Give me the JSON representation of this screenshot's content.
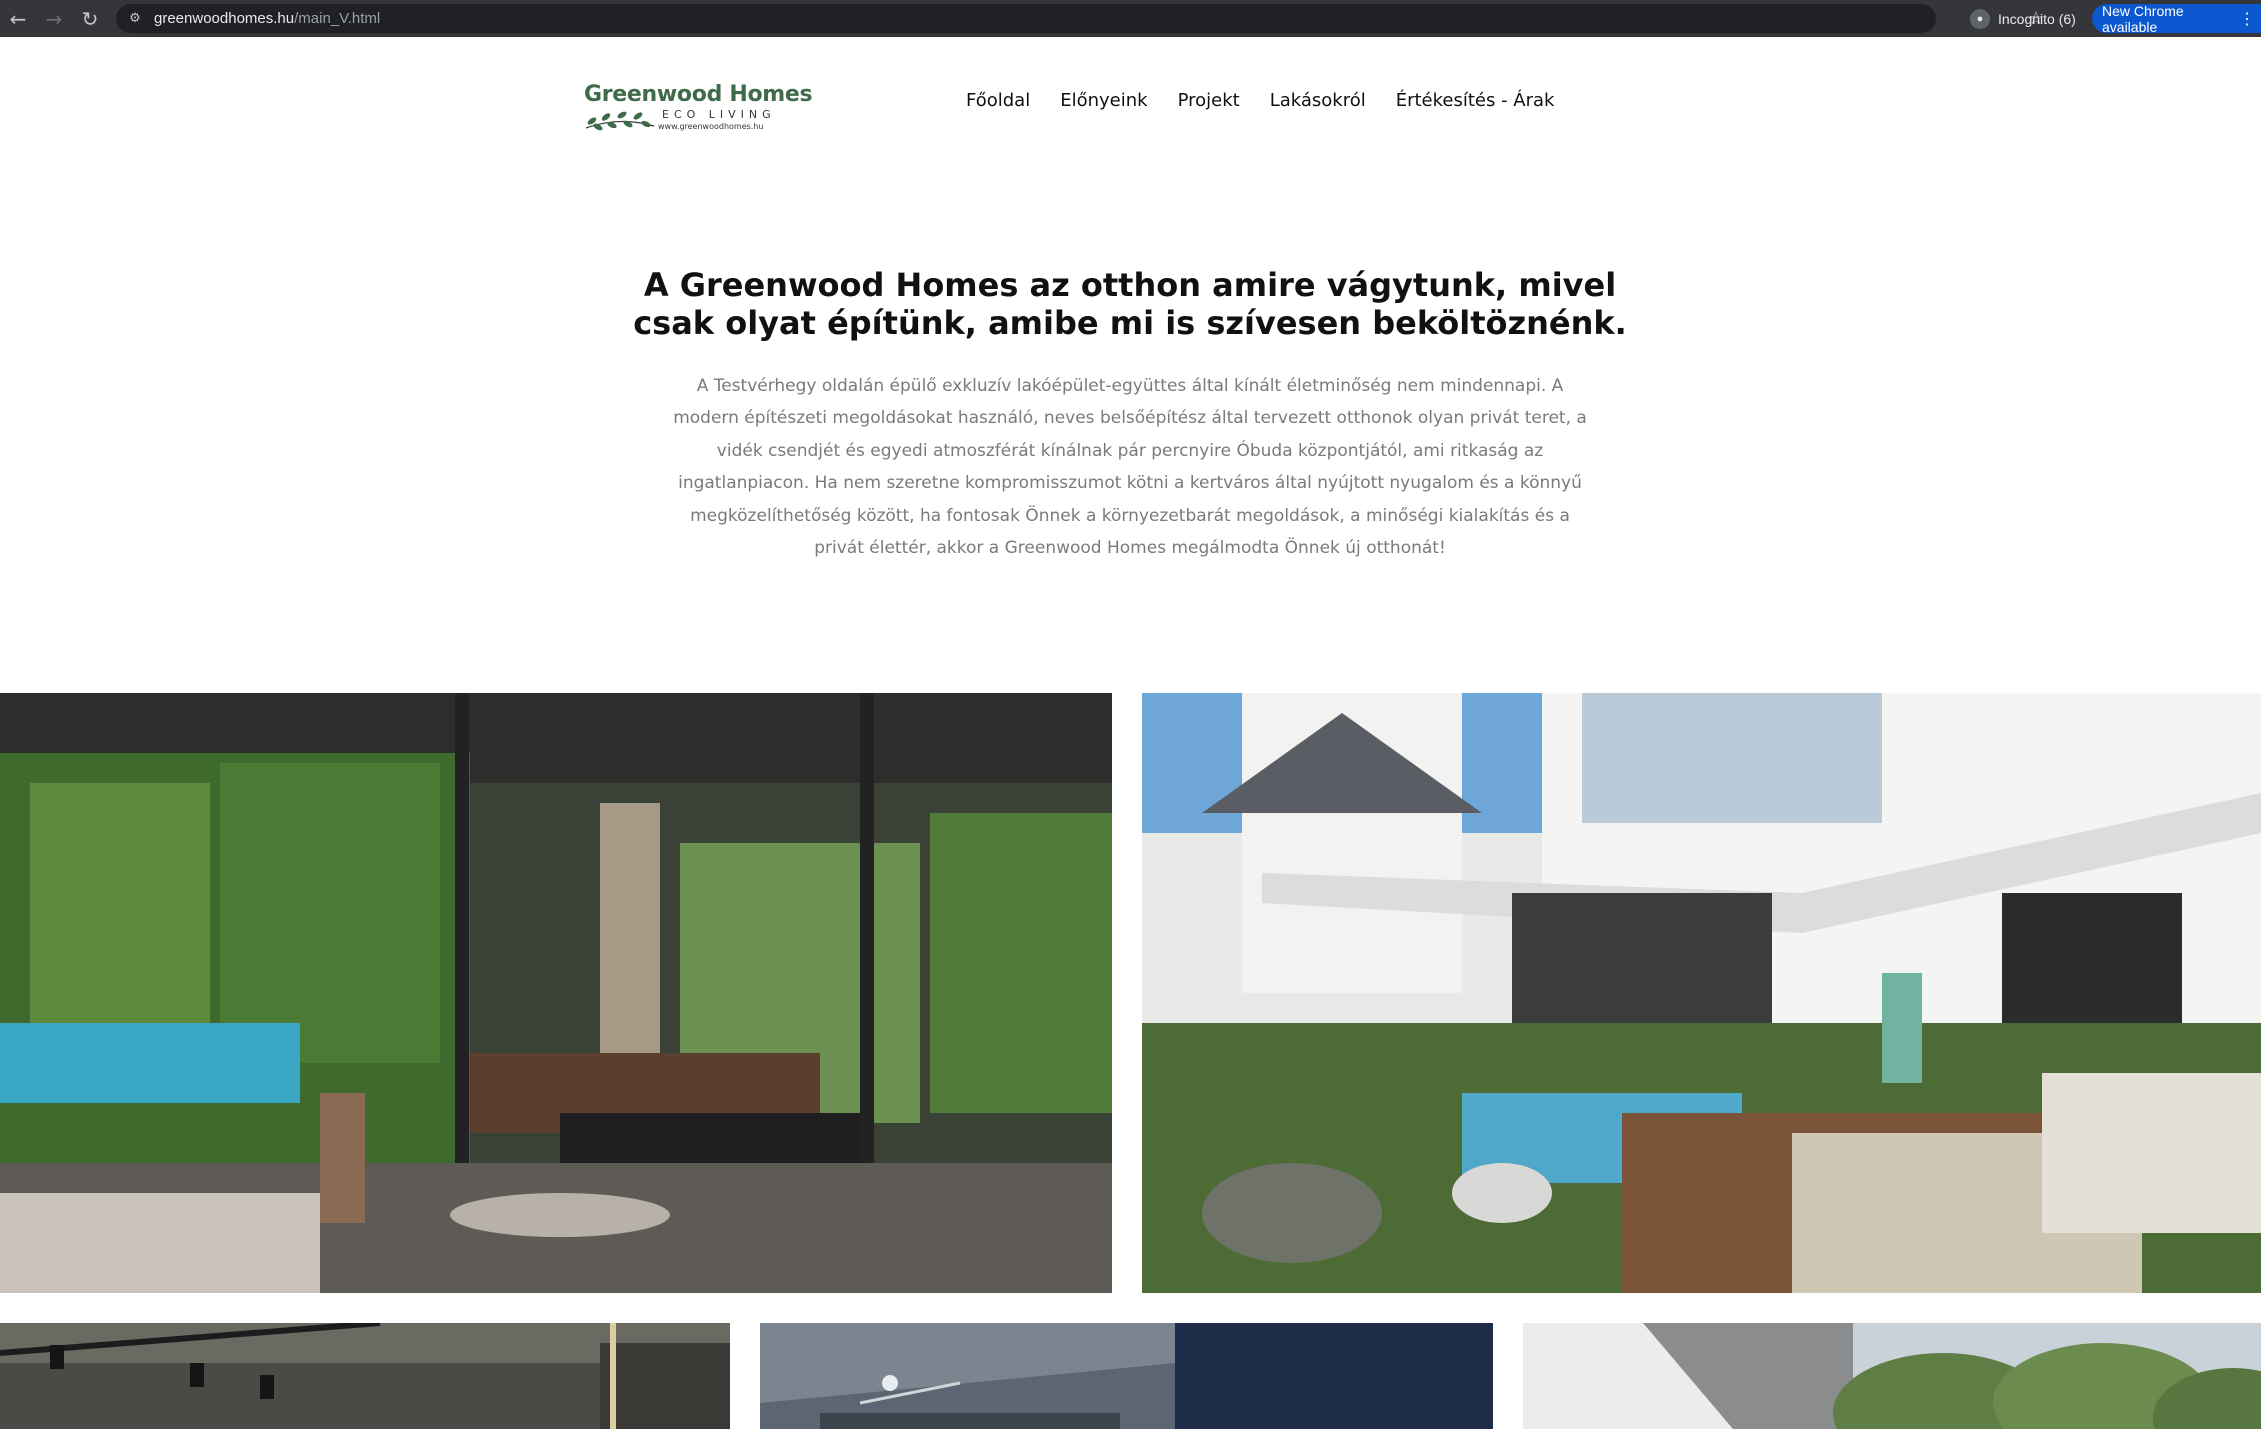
{
  "browser": {
    "url_host": "greenwoodhomes.hu",
    "url_path": "/main_V.html",
    "incognito_label": "Incognito (6)",
    "update_label": "New Chrome available"
  },
  "site": {
    "logo": {
      "title": "Greenwood Homes",
      "subtitle": "ECO LIVING",
      "url": "www.greenwoodhomes.hu"
    },
    "nav": [
      {
        "label": "Főoldal"
      },
      {
        "label": "Előnyeink"
      },
      {
        "label": "Projekt"
      },
      {
        "label": "Lakásokról"
      },
      {
        "label": "Értékesítés - Árak"
      }
    ]
  },
  "hero": {
    "headline": "A Greenwood Homes az otthon amire vágytunk, mivel csak olyat építünk, amibe mi is szívesen beköltöznénk.",
    "intro": "A Testvérhegy oldalán épülő exkluzív lakóépület-együttes által kínált életminőség nem mindennapi. A modern építészeti megoldásokat használó, neves belsőépítész által tervezett otthonok olyan privát teret, a vidék csendjét és egyedi atmoszférát kínálnak pár percnyire Óbuda központjától, ami ritkaság az ingatlanpiacon. Ha nem szeretne kompromisszumot kötni a kertváros által nyújtott nyugalom és a könnyű megközelíthetőség között, ha fontosak Önnek a környezetbarát megoldások, a minőségi kialakítás és a privát élettér, akkor a Greenwood Homes megálmodta Önnek új otthonát!"
  },
  "colors": {
    "brand_green": "#3f6b4a",
    "chrome_bar": "#35363a",
    "update_blue": "#0b57d0"
  },
  "icons": [
    "back-arrow-icon",
    "forward-arrow-icon",
    "reload-icon",
    "site-settings-icon",
    "star-icon",
    "incognito-icon",
    "more-icon"
  ]
}
